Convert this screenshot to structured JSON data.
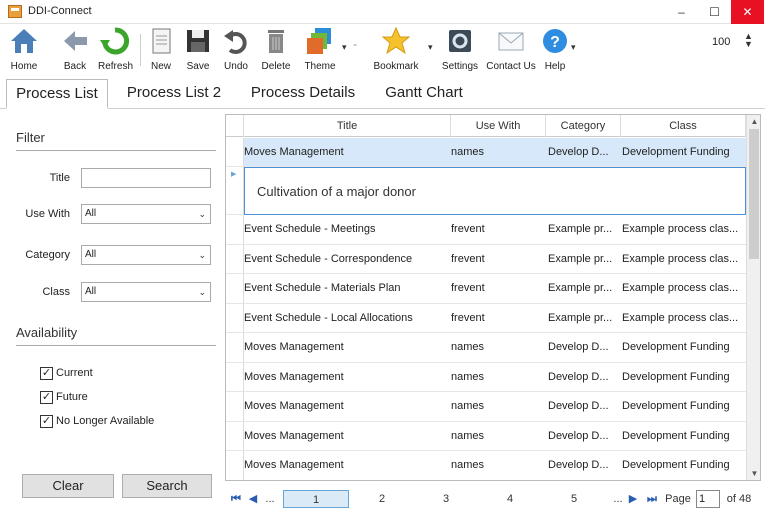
{
  "window": {
    "title": "DDI-Connect"
  },
  "toolbar": {
    "home": "Home",
    "back": "Back",
    "refresh": "Refresh",
    "new": "New",
    "save": "Save",
    "undo": "Undo",
    "delete": "Delete",
    "theme": "Theme",
    "bookmark": "Bookmark",
    "settings": "Settings",
    "contact": "Contact Us",
    "help": "Help",
    "zoom": "100"
  },
  "tabs": [
    "Process List",
    "Process List 2",
    "Process Details",
    "Gantt Chart"
  ],
  "filter": {
    "heading": "Filter",
    "title_label": "Title",
    "title_value": "",
    "use_with_label": "Use With",
    "use_with_value": "All",
    "category_label": "Category",
    "category_value": "All",
    "class_label": "Class",
    "class_value": "All"
  },
  "availability": {
    "heading": "Availability",
    "options": [
      {
        "label": "Current",
        "checked": true
      },
      {
        "label": "Future",
        "checked": true
      },
      {
        "label": "No Longer Available",
        "checked": true
      }
    ]
  },
  "buttons": {
    "clear": "Clear",
    "search": "Search"
  },
  "grid": {
    "columns": [
      "Title",
      "Use With",
      "Category",
      "Class"
    ],
    "selected_row": {
      "title": "Moves Management",
      "use_with": "names",
      "category": "Develop D...",
      "class": "Development Funding"
    },
    "detail_text": "Cultivation of a major donor",
    "rows": [
      {
        "title": "Event Schedule - Meetings",
        "use_with": "frevent",
        "category": "Example pr...",
        "class": "Example process clas..."
      },
      {
        "title": "Event Schedule - Correspondence",
        "use_with": "frevent",
        "category": "Example pr...",
        "class": "Example process clas..."
      },
      {
        "title": "Event Schedule - Materials Plan",
        "use_with": "frevent",
        "category": "Example pr...",
        "class": "Example process clas..."
      },
      {
        "title": "Event Schedule - Local Allocations",
        "use_with": "frevent",
        "category": "Example pr...",
        "class": "Example process clas..."
      },
      {
        "title": "Moves Management",
        "use_with": "names",
        "category": "Develop D...",
        "class": "Development Funding"
      },
      {
        "title": "Moves Management",
        "use_with": "names",
        "category": "Develop D...",
        "class": "Development Funding"
      },
      {
        "title": "Moves Management",
        "use_with": "names",
        "category": "Develop D...",
        "class": "Development Funding"
      },
      {
        "title": "Moves Management",
        "use_with": "names",
        "category": "Develop D...",
        "class": "Development Funding"
      },
      {
        "title": "Moves Management",
        "use_with": "names",
        "category": "Develop D...",
        "class": "Development Funding"
      }
    ]
  },
  "pager": {
    "first": "⏮",
    "prev": "◀",
    "ellipsis_left": "...",
    "pages": [
      "1",
      "2",
      "3",
      "4",
      "5"
    ],
    "current_page": "1",
    "ellipsis_right": "...",
    "next": "▶",
    "last": "⏭",
    "page_label": "Page",
    "page_value": "1",
    "of_label": "of 48"
  },
  "colors": {
    "accent": "#2a5db0",
    "selected_row": "#d6e8f9",
    "close": "#e81123"
  }
}
